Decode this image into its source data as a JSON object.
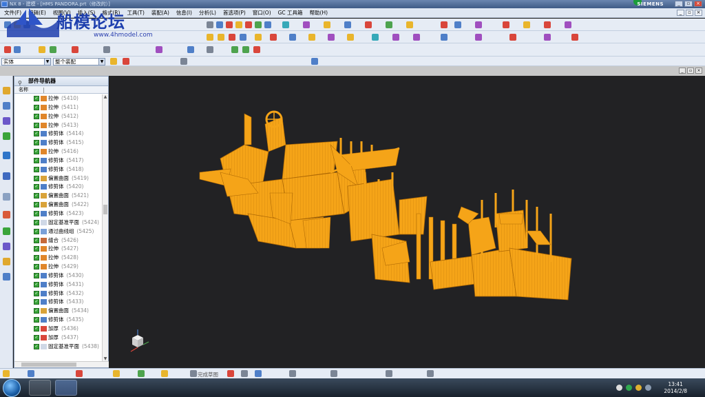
{
  "window": {
    "title": "NX 8 - 建模 - [HMS PANDORA.prt（修改的）]",
    "brand": "SIEMENS"
  },
  "menu": [
    "文件(F)",
    "编辑(E)",
    "视图(V)",
    "插入(S)",
    "格式(R)",
    "工具(T)",
    "装配(A)",
    "信息(I)",
    "分析(L)",
    "首选项(P)",
    "窗口(O)",
    "GC 工具箱",
    "帮助(H)"
  ],
  "selection": {
    "filter_type": "实体",
    "scope": "整个装配"
  },
  "navigator": {
    "title": "部件导航器",
    "column_name": "名称",
    "features": [
      {
        "name": "拉伸",
        "id": "(5410)",
        "icon": "extrude-icon"
      },
      {
        "name": "拉伸",
        "id": "(5411)",
        "icon": "extrude-icon"
      },
      {
        "name": "拉伸",
        "id": "(5412)",
        "icon": "extrude-icon"
      },
      {
        "name": "拉伸",
        "id": "(5413)",
        "icon": "extrude-icon"
      },
      {
        "name": "修剪体",
        "id": "(5414)",
        "icon": "trim-body-icon"
      },
      {
        "name": "修剪体",
        "id": "(5415)",
        "icon": "trim-body-icon"
      },
      {
        "name": "拉伸",
        "id": "(5416)",
        "icon": "extrude-icon"
      },
      {
        "name": "修剪体",
        "id": "(5417)",
        "icon": "trim-body-icon"
      },
      {
        "name": "修剪体",
        "id": "(5418)",
        "icon": "trim-body-icon"
      },
      {
        "name": "偏置曲面",
        "id": "(5419)",
        "icon": "offset-surface-icon"
      },
      {
        "name": "修剪体",
        "id": "(5420)",
        "icon": "trim-body-icon"
      },
      {
        "name": "偏置曲面",
        "id": "(5421)",
        "icon": "offset-surface-icon"
      },
      {
        "name": "偏置曲面",
        "id": "(5422)",
        "icon": "offset-surface-icon"
      },
      {
        "name": "修剪体",
        "id": "(5423)",
        "icon": "trim-body-icon"
      },
      {
        "name": "固定基准平面",
        "id": "(5424)",
        "icon": "datum-plane-icon"
      },
      {
        "name": "通过曲线组",
        "id": "(5425)",
        "icon": "through-curves-icon"
      },
      {
        "name": "缝合",
        "id": "(5426)",
        "icon": "sew-icon"
      },
      {
        "name": "拉伸",
        "id": "(5427)",
        "icon": "extrude-icon"
      },
      {
        "name": "拉伸",
        "id": "(5428)",
        "icon": "extrude-icon"
      },
      {
        "name": "拉伸",
        "id": "(5429)",
        "icon": "extrude-icon"
      },
      {
        "name": "修剪体",
        "id": "(5430)",
        "icon": "trim-body-icon"
      },
      {
        "name": "修剪体",
        "id": "(5431)",
        "icon": "trim-body-icon"
      },
      {
        "name": "修剪体",
        "id": "(5432)",
        "icon": "trim-body-icon"
      },
      {
        "name": "修剪体",
        "id": "(5433)",
        "icon": "trim-body-icon"
      },
      {
        "name": "偏置曲面",
        "id": "(5434)",
        "icon": "offset-surface-icon"
      },
      {
        "name": "修剪体",
        "id": "(5435)",
        "icon": "trim-body-icon"
      },
      {
        "name": "加厚",
        "id": "(5436)",
        "icon": "thicken-icon"
      },
      {
        "name": "加厚",
        "id": "(5437)",
        "icon": "thicken-icon"
      },
      {
        "name": "固定基准平面",
        "id": "(5438)",
        "icon": "datum-plane-icon"
      }
    ]
  },
  "bottom_toolbar": {
    "sketch_label": "完成草图"
  },
  "watermark": {
    "title": "船模论坛",
    "url": "www.4hmodel.com"
  },
  "taskbar": {
    "time": "13:41",
    "date": "2014/2/8"
  },
  "colors": {
    "model": "#f5a418",
    "viewport_bg": "#222224",
    "check": "#3aa43a"
  }
}
